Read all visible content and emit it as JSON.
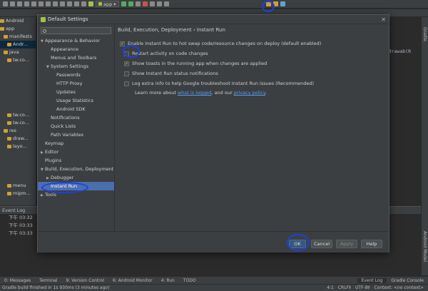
{
  "ide": {
    "project_label": "app",
    "android_label": "Android",
    "run_config": "app",
    "tree": [
      "Android",
      "app",
      "manifests",
      "Andr...",
      "java",
      "tw.co...",
      "tw.co...",
      "tw.co...",
      "res",
      "draw...",
      "layo...",
      "menu",
      "mipm..."
    ],
    "editor_right_text": "e,R.drawab(R",
    "event_log_title": "Event Log",
    "log_entries": [
      "下午 03:32",
      "下午 03:33",
      "下午 03:33"
    ],
    "right_gutter_top": "Gradle",
    "right_gutter_bottom": "Android Model"
  },
  "tool_windows": {
    "messages": "0: Messages",
    "terminal": "Terminal",
    "vcs": "9: Version Control",
    "monitor": "6: Android Monitor",
    "run": "4: Run",
    "todo": "TODO",
    "event_log": "Event Log",
    "gradle_console": "Gradle Console"
  },
  "status_bar": {
    "message": "Gradle build finished in 1s 930ms (3 minutes ago)",
    "position": "4:1",
    "line_sep": "CRLF‡",
    "encoding": "UTF-8‡",
    "context": "Context: <no context>"
  },
  "dialog": {
    "title": "Default Settings",
    "search_placeholder": "",
    "breadcrumb": "Build, Execution, Deployment › Instant Run",
    "nav": [
      {
        "label": "Appearance & Behavior",
        "level": 0,
        "arrow": "▼"
      },
      {
        "label": "Appearance",
        "level": 1,
        "arrow": ""
      },
      {
        "label": "Menus and Toolbars",
        "level": 1,
        "arrow": ""
      },
      {
        "label": "System Settings",
        "level": 1,
        "arrow": "▼"
      },
      {
        "label": "Passwords",
        "level": 2,
        "arrow": ""
      },
      {
        "label": "HTTP Proxy",
        "level": 2,
        "arrow": ""
      },
      {
        "label": "Updates",
        "level": 2,
        "arrow": ""
      },
      {
        "label": "Usage Statistics",
        "level": 2,
        "arrow": ""
      },
      {
        "label": "Android SDK",
        "level": 2,
        "arrow": ""
      },
      {
        "label": "Notifications",
        "level": 1,
        "arrow": ""
      },
      {
        "label": "Quick Lists",
        "level": 1,
        "arrow": ""
      },
      {
        "label": "Path Variables",
        "level": 1,
        "arrow": ""
      },
      {
        "label": "Keymap",
        "level": 0,
        "arrow": ""
      },
      {
        "label": "Editor",
        "level": 0,
        "arrow": "▶"
      },
      {
        "label": "Plugins",
        "level": 0,
        "arrow": ""
      },
      {
        "label": "Build, Execution, Deployment",
        "level": 0,
        "arrow": "▼"
      },
      {
        "label": "Debugger",
        "level": 1,
        "arrow": "▶"
      },
      {
        "label": "Instant Run",
        "level": 1,
        "arrow": "",
        "selected": true
      },
      {
        "label": "Tools",
        "level": 0,
        "arrow": "▶"
      }
    ],
    "options": [
      {
        "label": "Enable Instant Run to hot swap code/resource changes on deploy (default enabled)",
        "checked": true,
        "indent": 0
      },
      {
        "label": "Restart activity on code changes",
        "checked": false,
        "indent": 1
      },
      {
        "label": "Show toasts in the running app when changes are applied",
        "checked": true,
        "indent": 1
      },
      {
        "label": "Show Instant Run status notifications",
        "checked": false,
        "indent": 1
      },
      {
        "label": "Log extra info to help Google troubleshoot Instant Run issues (Recommended)",
        "checked": false,
        "indent": 1
      }
    ],
    "learn_prefix": "Learn more about ",
    "learn_link1": "what is logged",
    "learn_middle": ", and our ",
    "learn_link2": "privacy policy",
    "learn_suffix": ".",
    "buttons": {
      "ok": "OK",
      "cancel": "Cancel",
      "apply": "Apply",
      "help": "Help"
    }
  },
  "colors": {
    "selection": "#4b6eaf",
    "annotation": "#1f3fe0",
    "link": "#589df6"
  }
}
